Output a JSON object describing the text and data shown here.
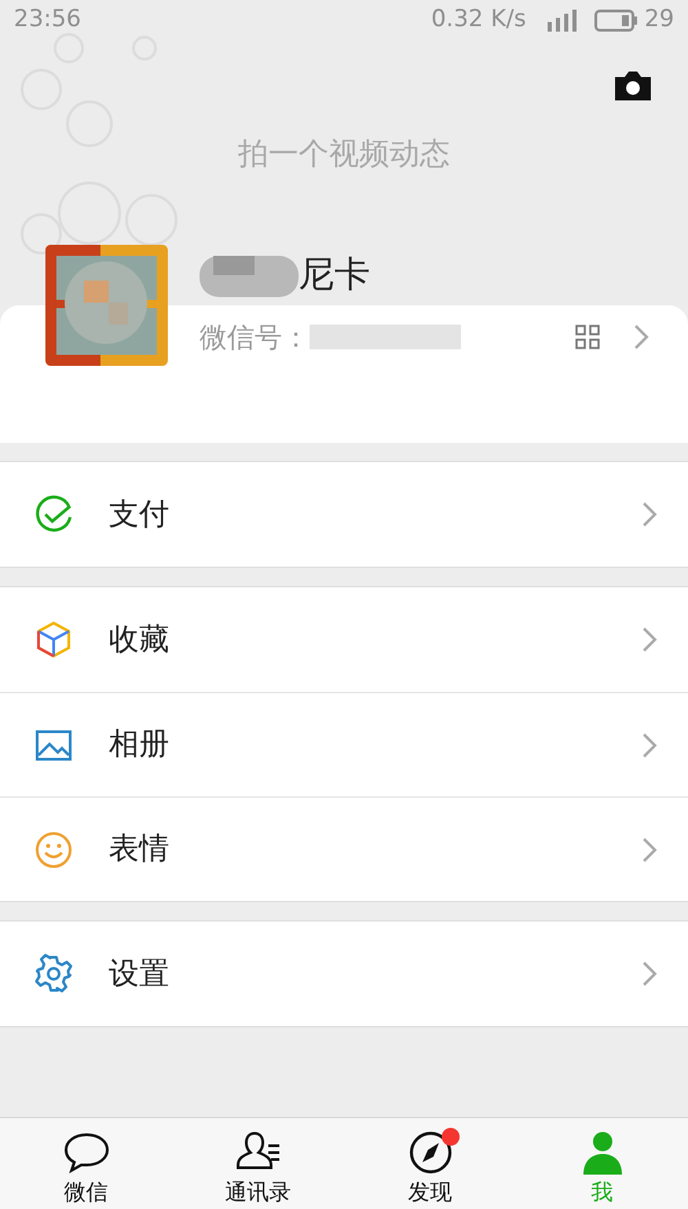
{
  "status_bar": {
    "time": "23:56",
    "speed": "0.32 K/s",
    "battery": "29"
  },
  "header": {
    "caption": "拍一个视频动态"
  },
  "profile": {
    "name": "尼卡",
    "id_label": "微信号："
  },
  "groups": [
    [
      {
        "kind": "pay",
        "label": "支付"
      }
    ],
    [
      {
        "kind": "favorites",
        "label": "收藏"
      },
      {
        "kind": "album",
        "label": "相册"
      },
      {
        "kind": "stickers",
        "label": "表情"
      }
    ],
    [
      {
        "kind": "settings",
        "label": "设置"
      }
    ]
  ],
  "tabs": [
    {
      "kind": "chats",
      "label": "微信",
      "selected": false,
      "badge": false
    },
    {
      "kind": "contacts",
      "label": "通讯录",
      "selected": false,
      "badge": false
    },
    {
      "kind": "discover",
      "label": "发现",
      "selected": false,
      "badge": true
    },
    {
      "kind": "me",
      "label": "我",
      "selected": true,
      "badge": false
    }
  ]
}
